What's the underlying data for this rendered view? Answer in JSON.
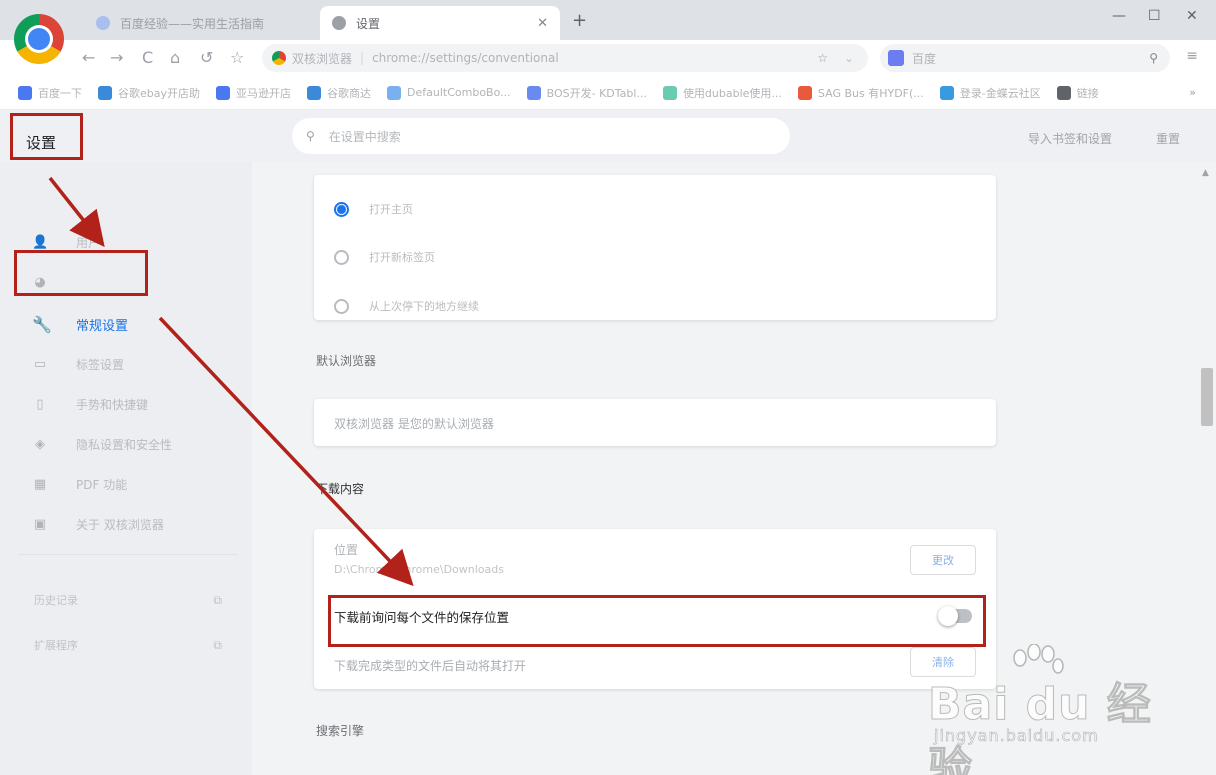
{
  "browser": {
    "tabs": [
      {
        "label": "百度经验——实用生活指南",
        "active": false
      },
      {
        "label": "设置",
        "active": true
      }
    ],
    "new_tab": "+",
    "window_controls": [
      "—",
      "☐",
      "✕"
    ],
    "nav_buttons": [
      "←",
      "→",
      "C",
      "⌂",
      "↺",
      "☆"
    ],
    "address": {
      "site_name": "双核浏览器",
      "url": "chrome://settings/conventional"
    },
    "search_engine_placeholder": "百度",
    "bookmarks": [
      {
        "label": "百度一下",
        "color": "#4a78f0"
      },
      {
        "label": "谷歌ebay开店助",
        "color": "#3b8ad9"
      },
      {
        "label": "亚马逊开店",
        "color": "#4a78f0"
      },
      {
        "label": "谷歌商达",
        "color": "#3b8ad9"
      },
      {
        "label": "DefaultComboBo...",
        "color": "#7ab0f0"
      },
      {
        "label": "BOS开发- KDTabl...",
        "color": "#6a8af0"
      },
      {
        "label": "使用dubable使用...",
        "color": "#6acbb0"
      },
      {
        "label": "SAG Bus 有HYDF(...",
        "color": "#e85a3a"
      },
      {
        "label": "登录-金蝶云社区",
        "color": "#3a9ae0"
      },
      {
        "label": "链接",
        "color": "#606468"
      }
    ],
    "more_bookmarks": "»"
  },
  "settings": {
    "title": "设置",
    "search_placeholder": "在设置中搜索",
    "header_links": [
      "导入书签和设置",
      "重置"
    ],
    "sidebar": [
      {
        "label": "用户",
        "icon": "person-icon",
        "glyph": "👤",
        "active": false
      },
      {
        "label": "",
        "icon": "palette-icon",
        "glyph": "◕",
        "active": false
      },
      {
        "label": "常规设置",
        "icon": "wrench-icon",
        "glyph": "🔧",
        "active": true
      },
      {
        "label": "标签设置",
        "icon": "tab-icon",
        "glyph": "▭",
        "active": false
      },
      {
        "label": "手势和快捷键",
        "icon": "mouse-icon",
        "glyph": "▯",
        "active": false
      },
      {
        "label": "隐私设置和安全性",
        "icon": "shield-icon",
        "glyph": "◈",
        "active": false
      },
      {
        "label": "PDF 功能",
        "icon": "pdf-icon",
        "glyph": "▦",
        "active": false
      },
      {
        "label": "关于 双核浏览器",
        "icon": "info-icon",
        "glyph": "▣",
        "active": false
      }
    ],
    "sidebar_links": [
      {
        "label": "历史记录"
      },
      {
        "label": "扩展程序"
      }
    ],
    "startup_options": [
      {
        "label": "打开主页",
        "checked": true
      },
      {
        "label": "打开新标签页",
        "checked": false
      },
      {
        "label": "从上次停下的地方继续",
        "checked": false
      }
    ],
    "default_browser_section": "默认浏览器",
    "default_browser_text": "双核浏览器 是您的默认浏览器",
    "downloads_section": "下载内容",
    "location_label": "位置",
    "location_value": "D:\\Chrome\\Chrome\\Downloads",
    "change_button": "更改",
    "ask_where_to_save": "下载前询问每个文件的保存位置",
    "ask_toggle_on": false,
    "auto_open_text": "下载完成类型的文件后自动将其打开",
    "clear_button": "清除",
    "search_engine_section": "搜索引擎"
  },
  "watermark": {
    "logo": "Bai du 经验",
    "url": "jingyan.baidu.com"
  },
  "colors": {
    "accent": "#1a73e8",
    "annotation": "#b2221a"
  }
}
